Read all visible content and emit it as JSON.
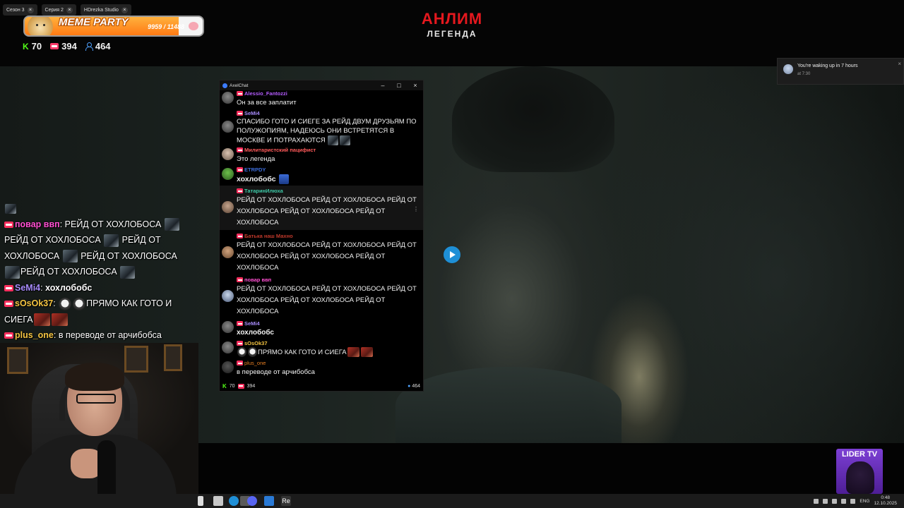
{
  "brand": {
    "title": "АНЛИМ",
    "subtitle": "ЛЕГЕНДА"
  },
  "tabs": [
    {
      "label": "Сезон 3"
    },
    {
      "label": "Серия 2"
    },
    {
      "label": "HDrezka Studio"
    }
  ],
  "meme_party": {
    "title": "MEME PARTY",
    "count": "9959 / 11488",
    "current": 9959,
    "target": 11488
  },
  "top_stats": {
    "kick": "70",
    "vk": "394",
    "viewers": "464"
  },
  "overlay_chat": [
    {
      "nick": "повар ввп",
      "text": "РЕЙД ОТ ХОХЛОБОСА",
      "color": "#ff4fd1"
    },
    {
      "text": "РЕЙД ОТ ХОХЛОБОСА"
    },
    {
      "text": "РЕЙД ОТ"
    },
    {
      "text": "ХОХЛОБОСА"
    },
    {
      "text": "РЕЙД ОТ ХОХЛОБОСА"
    },
    {
      "text": "РЕЙД ОТ ХОХЛОБОСА"
    },
    {
      "nick": "SeMi4",
      "text": "хохлобобс",
      "color": "#a78bfa"
    },
    {
      "nick": "sOsOk37",
      "text": "ПРЯМО КАК ГОТО И",
      "color": "#f5c542"
    },
    {
      "text": "СИЕГА"
    },
    {
      "nick": "plus_one",
      "text": "в переводе от арчибобса",
      "color": "#f5c542"
    }
  ],
  "axelchat": {
    "title": "AxelChat",
    "messages": [
      {
        "nick": "Alessio_Fantozzi",
        "color": "#b55cff",
        "text": "Он за все заплатит"
      },
      {
        "nick": "SeMi4",
        "color": "#a78bfa",
        "text": "СПАСИБО ГОТО И СИЕГЕ ЗА РЕЙД ДВУМ ДРУЗЬЯМ ПО ПОЛУЖОПИЯМ, НАДЕЮСЬ ОНИ ВСТРЕТЯТСЯ В МОСКВЕ И ПОТРАХАЮТСЯ"
      },
      {
        "nick": "Милитаристский пацифист",
        "color": "#ff5a5a",
        "text": "Это легенда"
      },
      {
        "nick": "ETRPDY",
        "color": "#3b6bd8",
        "text": "хохлобобс"
      },
      {
        "nick": "ТатаринИлюха",
        "color": "#3ec9a7",
        "text": "РЕЙД ОТ ХОХЛОБОСА РЕЙД ОТ ХОХЛОБОСА РЕЙД ОТ ХОХЛОБОСА РЕЙД ОТ ХОХЛОБОСА РЕЙД ОТ ХОХЛОБОСА"
      },
      {
        "nick": "Батька наш Махно",
        "color": "#c0392b",
        "text": "РЕЙД ОТ ХОХЛОБОСА РЕЙД ОТ ХОХЛОБОСА РЕЙД ОТ ХОХЛОБОСА РЕЙД ОТ ХОХЛОБОСА РЕЙД ОТ ХОХЛОБОСА"
      },
      {
        "nick": "повар ввп",
        "color": "#ff4fd1",
        "text": "РЕЙД ОТ ХОХЛОБОСА РЕЙД ОТ ХОХЛОБОСА РЕЙД ОТ ХОХЛОБОСА РЕЙД ОТ ХОХЛОБОСА РЕЙД ОТ ХОХЛОБОСА"
      },
      {
        "nick": "SeMi4",
        "color": "#a78bfa",
        "text": "хохлобобс"
      },
      {
        "nick": "sOsOk37",
        "color": "#f5c542",
        "text": "ПРЯМО КАК ГОТО И СИЕГА"
      },
      {
        "nick": "plus_one",
        "color": "#e67e22",
        "text": "в переводе от арчибобса"
      }
    ],
    "footer": {
      "kick": "70",
      "vk": "394",
      "viewers": "464"
    }
  },
  "notification": {
    "title": "You're waking up in 7 hours",
    "time": "at 7:30",
    "close": "×"
  },
  "lider_tv": {
    "label": "LIDER TV"
  },
  "taskbar": {
    "app_label": "Re",
    "lang": "ENG",
    "time": "0:48",
    "date": "12.10.2025"
  },
  "colors": {
    "brand_red": "#e5181e",
    "live_pink": "#ff2f5e",
    "kick_green": "#53fc18",
    "viewers_blue": "#4fa3ff"
  }
}
